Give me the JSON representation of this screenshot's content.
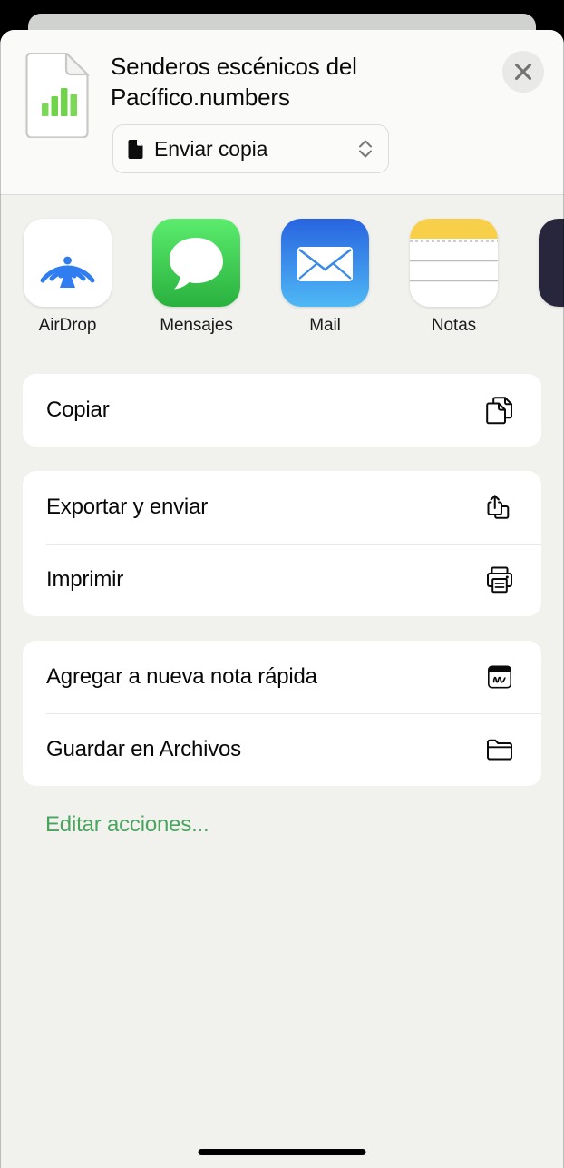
{
  "sheet": {
    "document": {
      "title": "Senderos escénicos del Pacífico.numbers",
      "icon": "numbers-document-icon"
    },
    "format_selector": {
      "label": "Enviar copia",
      "leading_icon": "document-icon",
      "trailing_icon": "up-down-chevron-icon"
    },
    "close_label": "×",
    "apps": [
      {
        "label": "AirDrop",
        "icon": "airdrop-icon"
      },
      {
        "label": "Mensajes",
        "icon": "messages-icon"
      },
      {
        "label": "Mail",
        "icon": "mail-icon"
      },
      {
        "label": "Notas",
        "icon": "notes-icon"
      },
      {
        "label": "",
        "icon": "podcasts-icon"
      }
    ],
    "action_groups": [
      {
        "rows": [
          {
            "label": "Copiar",
            "icon": "copy-icon"
          }
        ]
      },
      {
        "rows": [
          {
            "label": "Exportar y enviar",
            "icon": "export-share-icon"
          },
          {
            "label": "Imprimir",
            "icon": "printer-icon"
          }
        ]
      },
      {
        "rows": [
          {
            "label": "Agregar a nueva nota rápida",
            "icon": "quick-note-icon"
          },
          {
            "label": "Guardar en Archivos",
            "icon": "folder-icon"
          }
        ]
      }
    ],
    "edit_actions_label": "Editar acciones..."
  },
  "colors": {
    "accent_green": "#4aa45e",
    "numbers_green": "#6fd44a",
    "airdrop_blue": "#2f7df0",
    "messages_green": "#4cd964",
    "mail_blue": "#2a7ef0",
    "notes_yellow": "#f7cf49",
    "podcasts_dark": "#28263c",
    "sheet_bg": "#f1f2ee",
    "card_bg": "#ffffff"
  }
}
